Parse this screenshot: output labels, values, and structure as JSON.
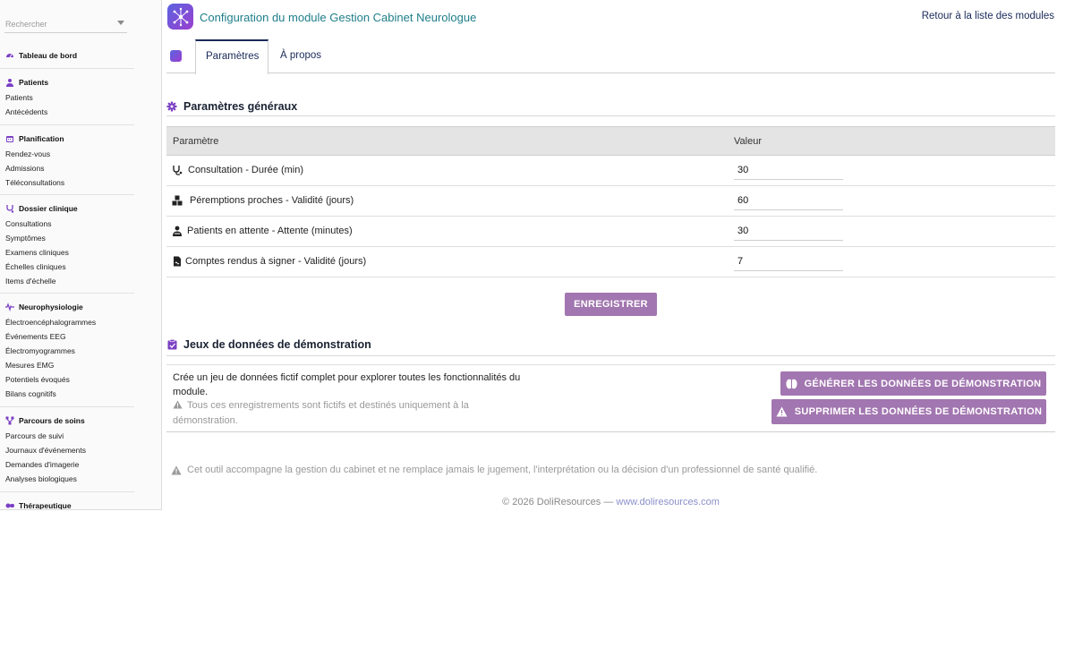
{
  "sidebar": {
    "search_placeholder": "Rechercher",
    "dashboard": "Tableau de bord",
    "sections": [
      {
        "title": "Patients",
        "icon": "user-injured-icon",
        "items": [
          "Patients",
          "Antécédents"
        ]
      },
      {
        "title": "Planification",
        "icon": "calendar-icon",
        "items": [
          "Rendez-vous",
          "Admissions",
          "Téléconsultations"
        ]
      },
      {
        "title": "Dossier clinique",
        "icon": "stethoscope-icon",
        "items": [
          "Consultations",
          "Symptômes",
          "Examens cliniques",
          "Échelles cliniques",
          "Items d'échelle"
        ]
      },
      {
        "title": "Neurophysiologie",
        "icon": "wave-icon",
        "items": [
          "Électroencéphalogrammes",
          "Événements EEG",
          "Électromyogrammes",
          "Mesures EMG",
          "Potentiels évoqués",
          "Bilans cognitifs"
        ]
      },
      {
        "title": "Parcours de soins",
        "icon": "sitemap-icon",
        "items": [
          "Parcours de suivi",
          "Journaux d'événements",
          "Demandes d'imagerie",
          "Analyses biologiques"
        ]
      },
      {
        "title": "Thérapeutique",
        "icon": "pills-icon",
        "items": []
      }
    ]
  },
  "header": {
    "title": "Configuration du module Gestion Cabinet Neurologue",
    "back_link": "Retour à la liste des modules"
  },
  "tabs": {
    "params": "Paramètres",
    "about": "À propos"
  },
  "general": {
    "title": "Paramètres généraux",
    "col_param": "Paramètre",
    "col_value": "Valeur",
    "rows": [
      {
        "label": "Consultation - Durée (min)",
        "value": "30",
        "icon": "stethoscope-icon"
      },
      {
        "label": "Péremptions proches - Validité (jours)",
        "value": "60",
        "icon": "boxes-icon"
      },
      {
        "label": "Patients en attente - Attente (minutes)",
        "value": "30",
        "icon": "user-injured-icon"
      },
      {
        "label": "Comptes rendus à signer - Validité (jours)",
        "value": "7",
        "icon": "file-signature-icon"
      }
    ],
    "save_label": "ENREGISTRER"
  },
  "demo": {
    "title": "Jeux de données de démonstration",
    "description": "Crée un jeu de données fictif complet pour explorer toutes les fonctionnalités du module.",
    "warning": "Tous ces enregistrements sont fictifs et destinés uniquement à la démonstration.",
    "generate_label": "GÉNÉRER LES DONNÉES DE DÉMONSTRATION",
    "delete_label": "SUPPRIMER LES DONNÉES DE DÉMONSTRATION"
  },
  "disclaimer": "Cet outil accompagne la gestion du cabinet et ne remplace jamais le jugement, l'interprétation ou la décision d'un professionnel de santé qualifié.",
  "footer": {
    "copyright": "© 2026 DoliResources — ",
    "link": "www.doliresources.com"
  },
  "colors": {
    "accent": "#7b3fc4",
    "button": "#a276b0",
    "title": "#1e7e8a",
    "link": "#1a2a5a"
  }
}
